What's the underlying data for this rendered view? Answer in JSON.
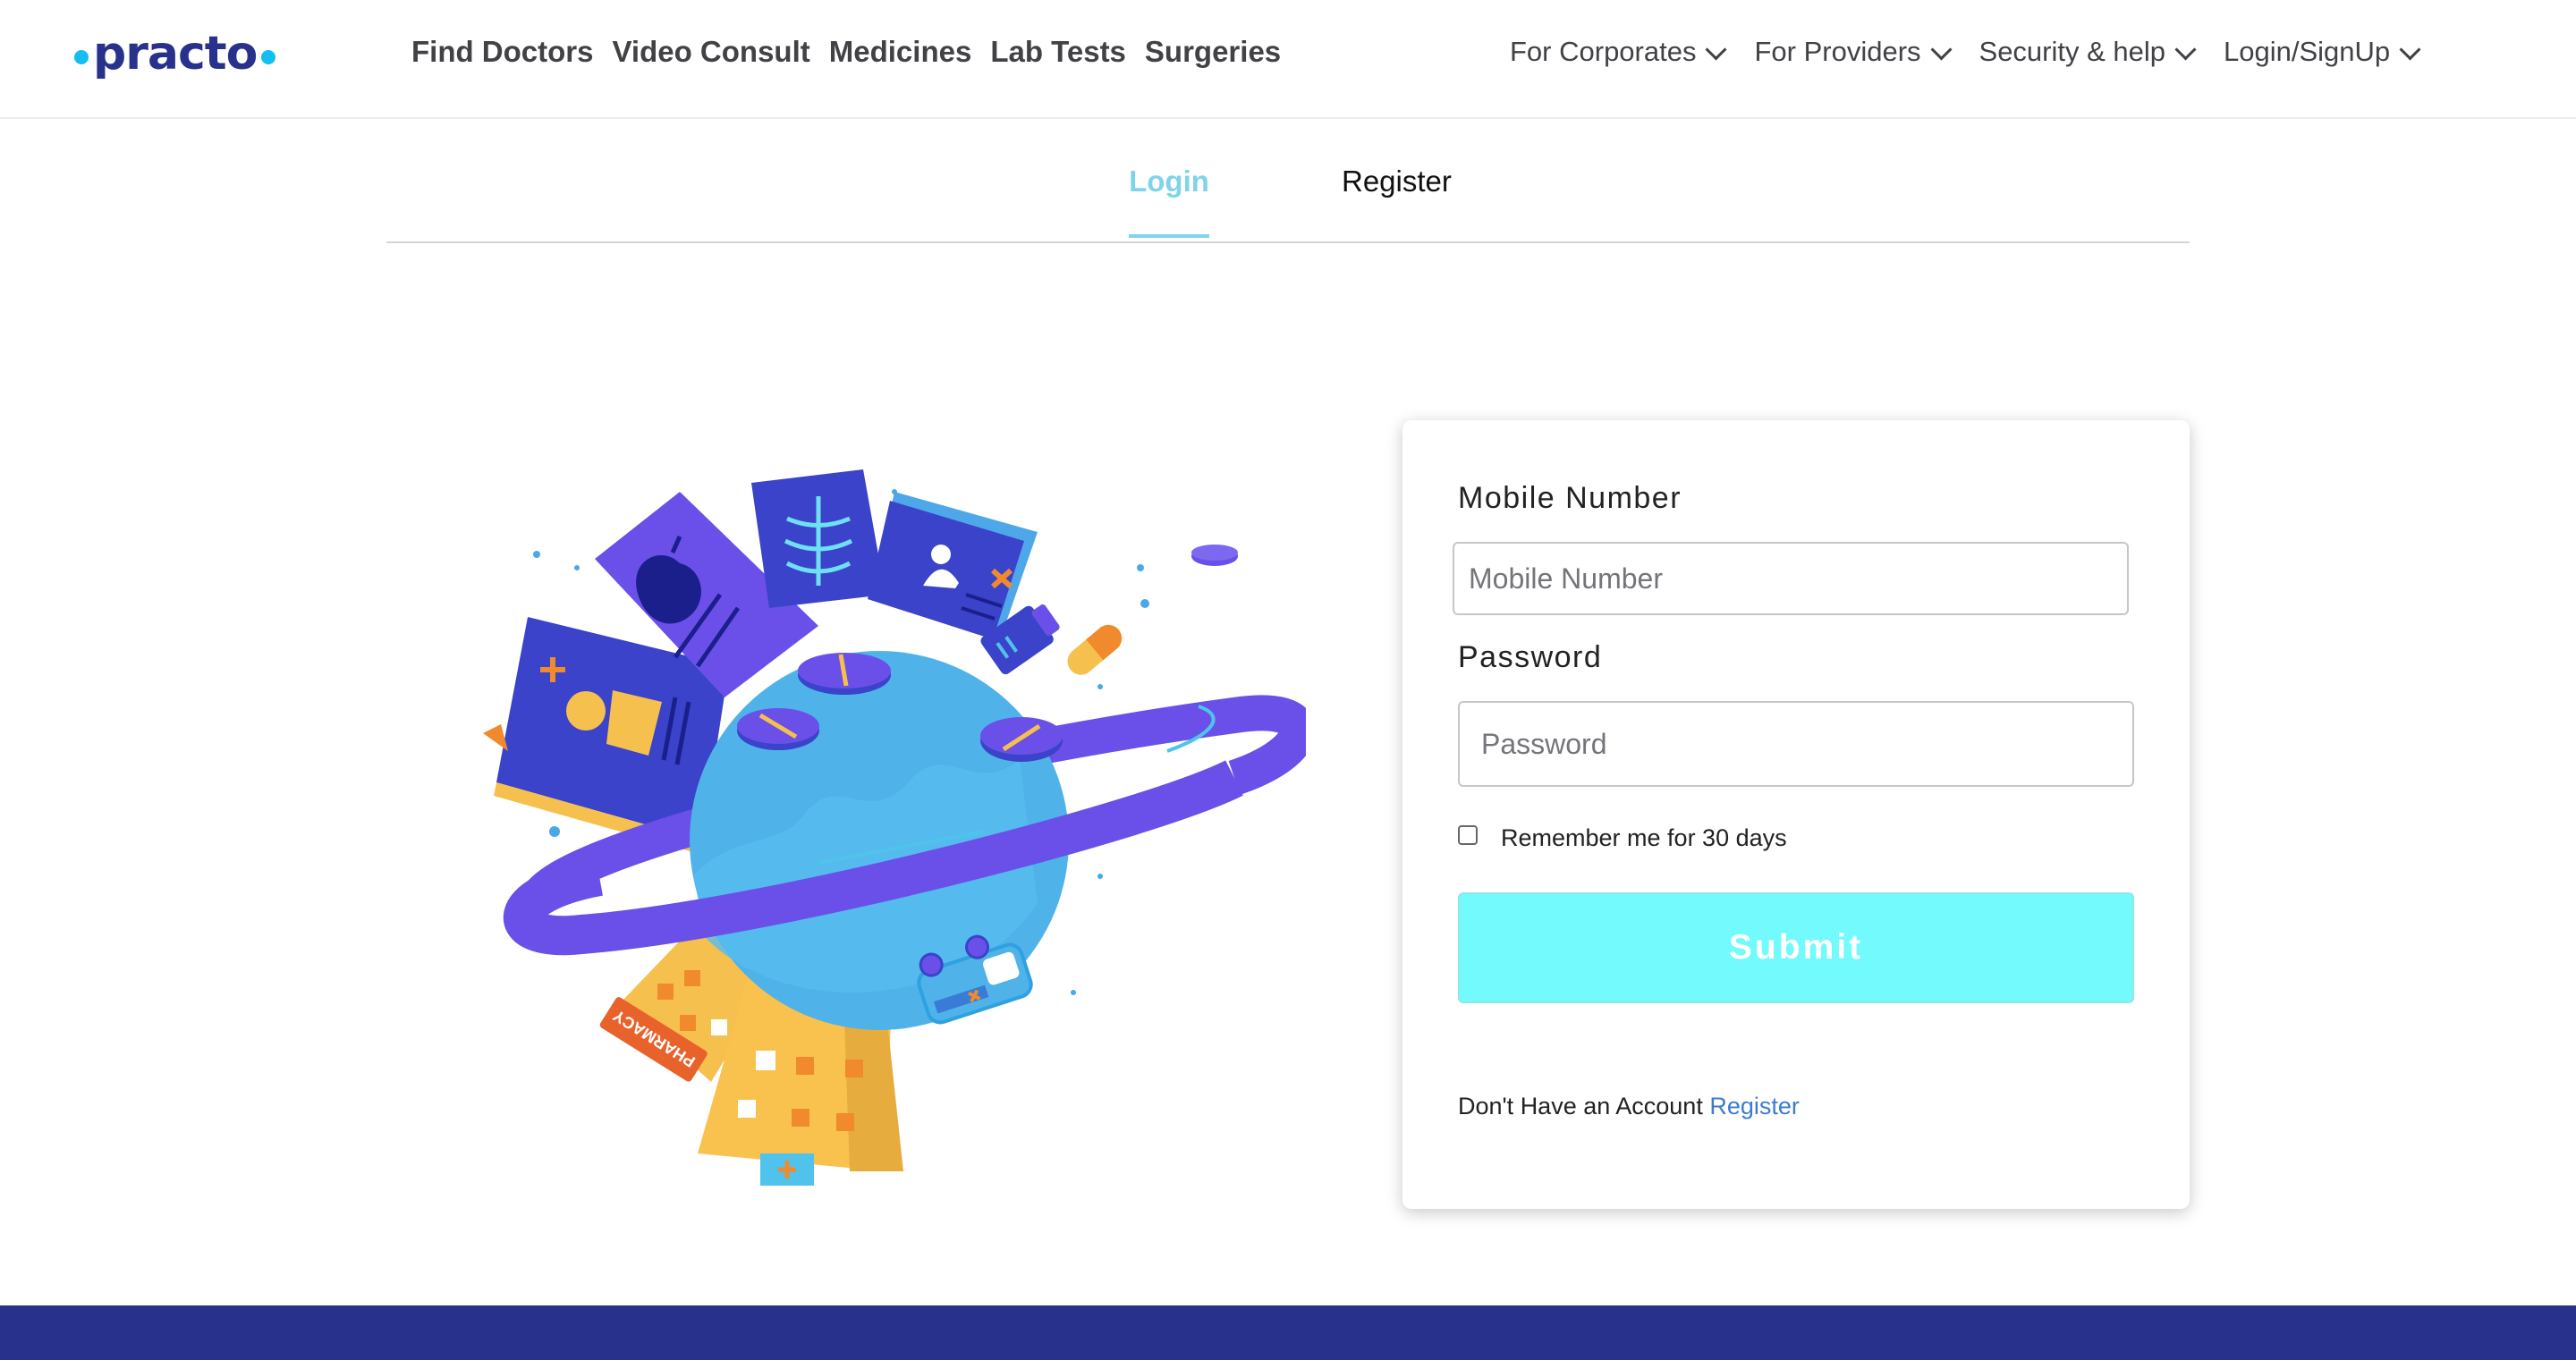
{
  "brand": {
    "logo_text": "practo",
    "accent": "#14bef0",
    "primary": "#28328c"
  },
  "nav": {
    "main": [
      "Find Doctors",
      "Video Consult",
      "Medicines",
      "Lab Tests",
      "Surgeries"
    ],
    "right": [
      "For Corporates",
      "For Providers",
      "Security & help",
      "Login/SignUp"
    ]
  },
  "tabs": {
    "login": "Login",
    "register": "Register",
    "active": "Login"
  },
  "form": {
    "mobile_label": "Mobile Number",
    "mobile_placeholder": "Mobile Number",
    "password_label": "Password",
    "password_placeholder": "Password",
    "remember_label": "Remember me for 30 days",
    "remember_checked": false,
    "submit_label": "Submit",
    "no_account_text": "Don't Have an Account",
    "register_link": "Register"
  },
  "illustration": {
    "sign_text": "PHARMACY",
    "icon": "healthcare-planet-illustration"
  },
  "colors": {
    "tab_active": "#7fd4ea",
    "submit_bg": "#72fafc",
    "link": "#3a7bd5",
    "footer": "#28328c"
  }
}
